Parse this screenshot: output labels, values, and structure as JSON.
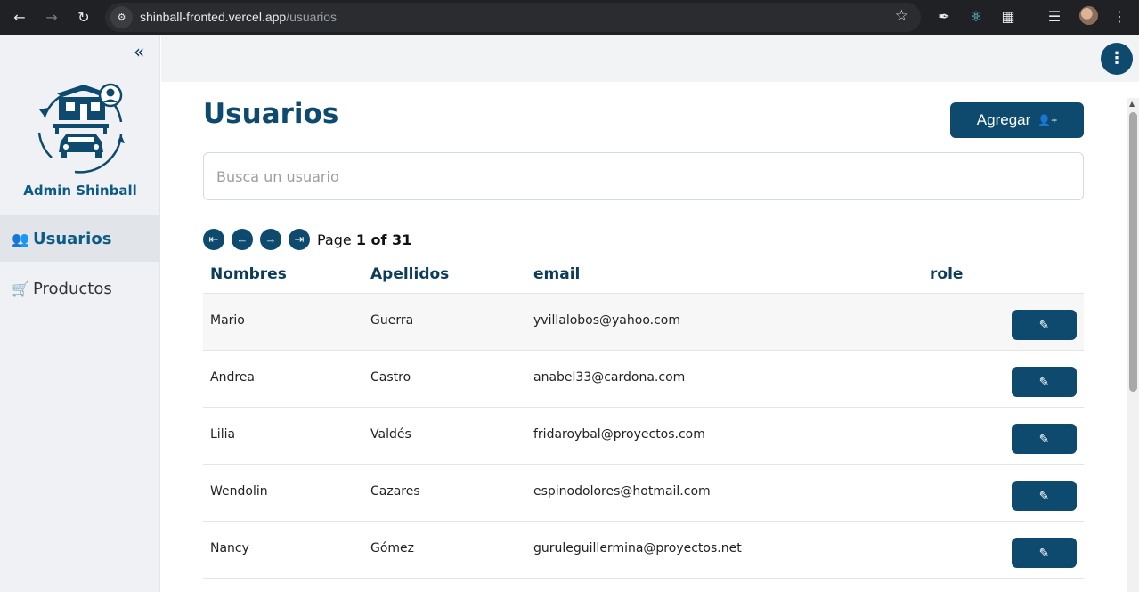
{
  "browser": {
    "url_host": "shinball-fronted.vercel.app",
    "url_path": "/usuarios"
  },
  "sidebar": {
    "brand": "Admin Shinball",
    "items": [
      {
        "label": "Usuarios",
        "icon": "users-icon",
        "active": true
      },
      {
        "label": "Productos",
        "icon": "cart-icon",
        "active": false
      }
    ]
  },
  "main": {
    "title": "Usuarios",
    "add_label": "Agregar",
    "search_placeholder": "Busca un usuario",
    "pager": {
      "page_label": "Page",
      "page_value": "1 of 31"
    },
    "columns": [
      "Nombres",
      "Apellidos",
      "email",
      "role"
    ],
    "rows": [
      {
        "nombres": "Mario",
        "apellidos": "Guerra",
        "email": "yvillalobos@yahoo.com",
        "role": ""
      },
      {
        "nombres": "Andrea",
        "apellidos": "Castro",
        "email": "anabel33@cardona.com",
        "role": ""
      },
      {
        "nombres": "Lilia",
        "apellidos": "Valdés",
        "email": "fridaroybal@proyectos.com",
        "role": ""
      },
      {
        "nombres": "Wendolin",
        "apellidos": "Cazares",
        "email": "espinodolores@hotmail.com",
        "role": ""
      },
      {
        "nombres": "Nancy",
        "apellidos": "Gómez",
        "email": "guruleguillermina@proyectos.net",
        "role": ""
      }
    ]
  },
  "colors": {
    "primary": "#0d4a6e",
    "brand_text": "#0d5a86",
    "sidebar_bg": "#eff1f4"
  }
}
